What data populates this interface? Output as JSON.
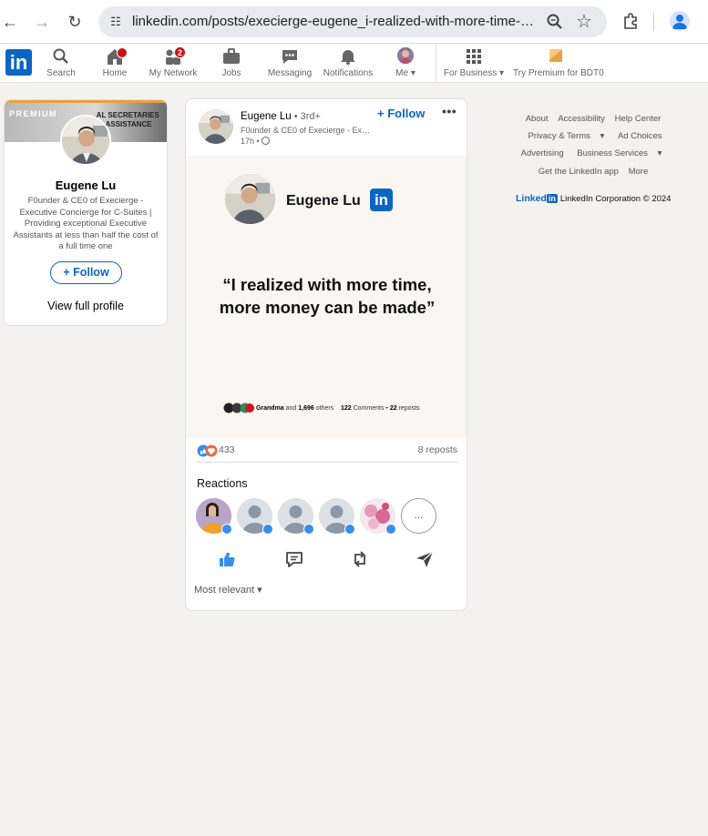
{
  "browser": {
    "url": "linkedin.com/posts/execierge-eugene_i-realized-with-more-time-mor..."
  },
  "nav": {
    "items": [
      {
        "label": "Search"
      },
      {
        "label": "Home"
      },
      {
        "label": "My Network",
        "badge": "2"
      },
      {
        "label": "Jobs"
      },
      {
        "label": "Messaging"
      },
      {
        "label": "Notifications"
      },
      {
        "label": "Me"
      },
      {
        "label": "For Business"
      },
      {
        "label": "Try Premium for BDT0"
      }
    ]
  },
  "profile_card": {
    "banner_premium": "PREMIUM",
    "banner_text": "...AL SECRETARIES\n...IN ASSISTANCE",
    "name": "Eugene Lu",
    "headline": "F0under & CE0 of Execierge - Executive Concierge for C-Suites | Providing exceptional Executive Assistants at less than half the cost of a full time one",
    "follow_label": "+ Follow",
    "view_profile": "View full profile"
  },
  "post": {
    "author": "Eugene Lu",
    "degree": " • 3rd+",
    "headline": "F0under & CE0 of Execierge - Executive Concierge for C-Suites",
    "time": "17h •",
    "follow_label": "Follow",
    "more": "•••",
    "media": {
      "name": "Eugene Lu",
      "quote": "“I realized with more time, more money can be made”",
      "stats_name": "Grandma",
      "stats_and": " and ",
      "stats_others_num": "1,696",
      "stats_others": " others",
      "stats_comments_num": "122",
      "stats_comments": " Comments • ",
      "stats_reposts_num": "22",
      "stats_reposts": " reposts"
    },
    "reaction_count": "433",
    "reposts": "8 reposts",
    "reactions_title": "Reactions",
    "more_reactions": "...",
    "sort_label": "Most relevant"
  },
  "footer": {
    "row1": [
      "About",
      "Accessibility",
      "Help Center"
    ],
    "row2": [
      "Privacy & Terms",
      "Ad Choices"
    ],
    "row3": [
      "Advertising",
      "Business Services"
    ],
    "row4": [
      "Get the LinkedIn app",
      "More"
    ],
    "copyright_word": "Linked",
    "copyright_box": "in",
    "copyright": "LinkedIn Corporation © 2024"
  },
  "colors": {
    "brand": "#0a66c2",
    "badge": "#cc1016",
    "page_bg": "#f3f2ef",
    "like": "#378fe9"
  }
}
